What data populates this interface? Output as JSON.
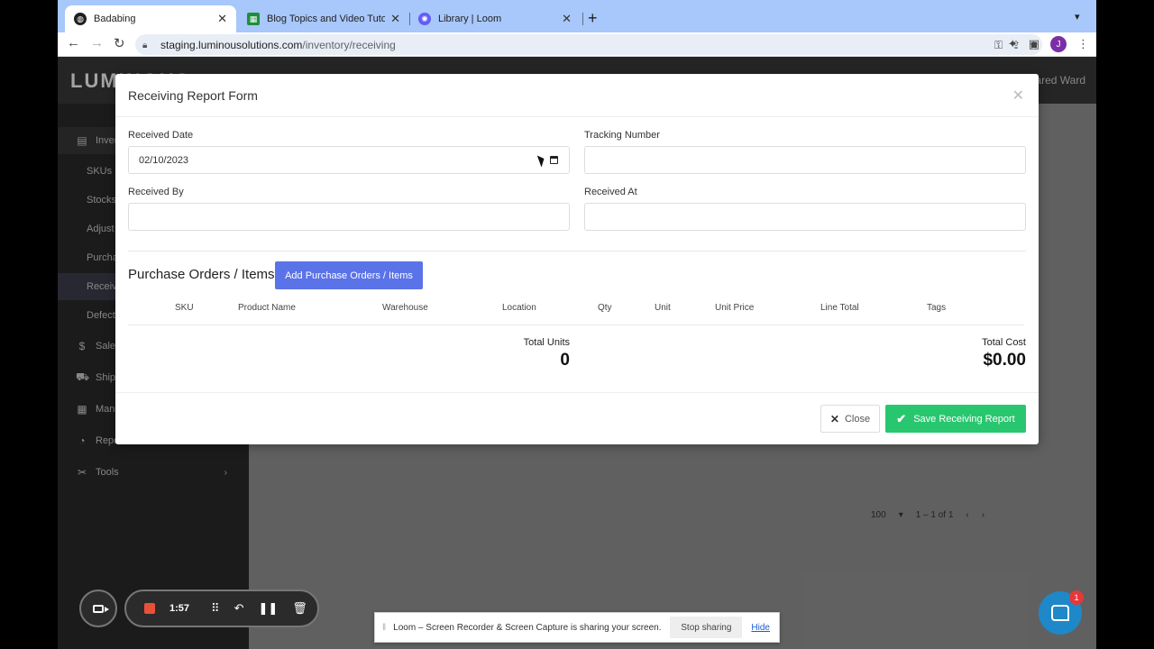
{
  "browser": {
    "tabs": [
      {
        "label": "Badabing",
        "favicon_color": "#1f1f1f"
      },
      {
        "label": "Blog Topics and Video Tutorial",
        "favicon_color": "#1e8e3e"
      },
      {
        "label": "Library | Loom",
        "favicon_color": "#625df5"
      }
    ],
    "new_tab": "+",
    "url_host": "staging.luminousolutions.com",
    "url_path": "/inventory/receiving",
    "profile_initial": "J"
  },
  "app": {
    "logo": "LUMINOUS",
    "user_name": "ared Ward",
    "sidebar": [
      {
        "label": "Inven",
        "icon": "calendar-icon"
      },
      {
        "label": "SKUs"
      },
      {
        "label": "Stocks"
      },
      {
        "label": "Adjust"
      },
      {
        "label": "Purcha"
      },
      {
        "label": "Receiv"
      },
      {
        "label": "Defect"
      },
      {
        "label": "Sales",
        "icon": "dollar-icon"
      },
      {
        "label": "Shipp",
        "icon": "truck-icon"
      },
      {
        "label": "Mana",
        "icon": "grid-icon"
      },
      {
        "label": "Repo",
        "icon": "report-icon"
      },
      {
        "label": "Tools",
        "icon": "tools-icon"
      }
    ],
    "pager": {
      "per_page": "100",
      "range": "1 – 1 of 1"
    }
  },
  "modal": {
    "title": "Receiving Report Form",
    "fields": {
      "received_date": {
        "label": "Received Date",
        "value": "02/10/2023"
      },
      "tracking_number": {
        "label": "Tracking Number",
        "value": ""
      },
      "received_by": {
        "label": "Received By",
        "value": ""
      },
      "received_at": {
        "label": "Received At",
        "value": ""
      }
    },
    "po_section_title": "Purchase Orders / Items",
    "add_po_button": "Add Purchase Orders / Items",
    "table_headers": [
      "SKU",
      "Product Name",
      "Warehouse",
      "Location",
      "Qty",
      "Unit",
      "Unit Price",
      "Line Total",
      "Tags"
    ],
    "total_units_label": "Total Units",
    "total_units_value": "0",
    "total_cost_label": "Total Cost",
    "total_cost_value": "$0.00",
    "close_button": "Close",
    "save_button": "Save Receiving Report"
  },
  "loom": {
    "timer": "1:57",
    "share_text": "Loom – Screen Recorder & Screen Capture is sharing your screen.",
    "stop_sharing": "Stop sharing",
    "hide": "Hide"
  },
  "chat": {
    "badge": "1"
  },
  "colors": {
    "primary": "#5b73e8",
    "success": "#28c76f",
    "record": "#e8503a",
    "chat": "#1e88c8"
  }
}
